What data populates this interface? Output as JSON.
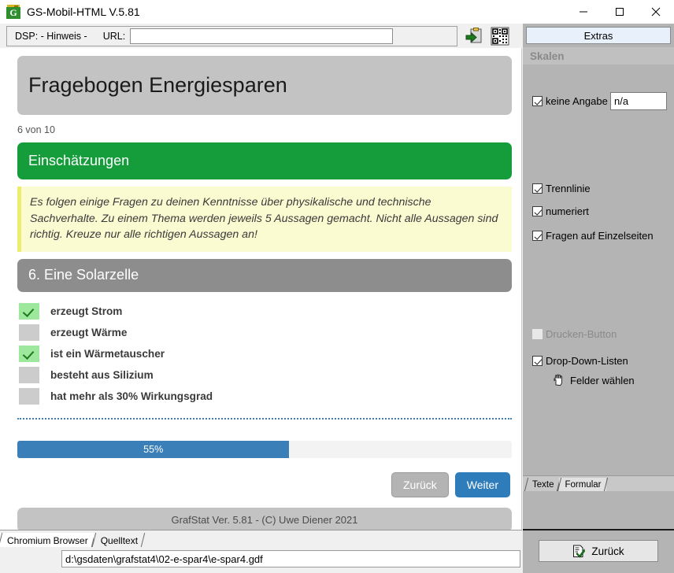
{
  "window": {
    "title": "GS-Mobil-HTML  V.5.81",
    "app_icon": "grafstat-logo-icon",
    "minimize": "minimize-icon",
    "maximize": "maximize-icon",
    "close": "close-icon"
  },
  "toolbar": {
    "dsp_label": "DSP: - Hinweis -",
    "url_label": "URL:",
    "url_value": "",
    "url_placeholder": "",
    "export_icon": "clipboard-export-icon",
    "qr_icon": "qr-code-icon"
  },
  "page": {
    "survey_title": "Fragebogen Energiesparen",
    "counter": "6 von 10",
    "section_banner": "Einschätzungen",
    "intro_text": "Es folgen einige Fragen zu deinen Kenntnisse über physikalische und technische Sachverhalte. Zu einem Thema werden jeweils 5 Aussagen gemacht. Nicht alle Aussagen sind richtig. Kreuze nur alle richtigen Aussagen an!",
    "question_header": "6. Eine Solarzelle",
    "options": [
      {
        "label": "erzeugt Strom",
        "checked": true
      },
      {
        "label": "erzeugt Wärme",
        "checked": false
      },
      {
        "label": "ist ein Wärmetauscher",
        "checked": true
      },
      {
        "label": "besteht aus Silizium",
        "checked": false
      },
      {
        "label": "hat mehr als 30% Wirkungsgrad",
        "checked": false
      }
    ],
    "progress_label": "55%",
    "progress_percent": 55,
    "back_button": "Zurück",
    "next_button": "Weiter",
    "footer": "GrafStat Ver. 5.81 - (C) Uwe Diener 2021"
  },
  "bottom": {
    "tabs": [
      {
        "label": "Chromium Browser",
        "active": true
      },
      {
        "label": "Quelltext",
        "active": false
      }
    ],
    "file_path": "d:\\gsdaten\\grafstat4\\02-e-spar4\\e-spar4.gdf"
  },
  "right_panel": {
    "extras_button": "Extras",
    "skalen_header": "Skalen",
    "keine_angabe": {
      "label": "keine Angabe",
      "checked": true
    },
    "na_value": "n/a",
    "checkboxes": [
      {
        "label": "Trennlinie",
        "checked": true,
        "disabled": false
      },
      {
        "label": "numeriert",
        "checked": true,
        "disabled": false
      },
      {
        "label": "Fragen auf Einzelseiten",
        "checked": true,
        "disabled": false
      },
      {
        "label": "Drucken-Button",
        "checked": false,
        "disabled": true
      },
      {
        "label": "Drop-Down-Listen",
        "checked": true,
        "disabled": false
      }
    ],
    "felder_waehlen": "Felder wählen",
    "felder_icon": "hand-pointer-icon",
    "tabs": [
      {
        "label": "Texte",
        "active": false
      },
      {
        "label": "Formular",
        "active": true
      }
    ],
    "zurueck_button": "Zurück",
    "zurueck_icon": "document-check-icon"
  },
  "colors": {
    "green_banner": "#159d3c",
    "gray_banner": "#8d8d8d",
    "progress_blue": "#3a7fb8",
    "next_blue": "#2e7cba",
    "yellow_box": "#fbfbd2",
    "checked_green": "#9ee89e"
  }
}
